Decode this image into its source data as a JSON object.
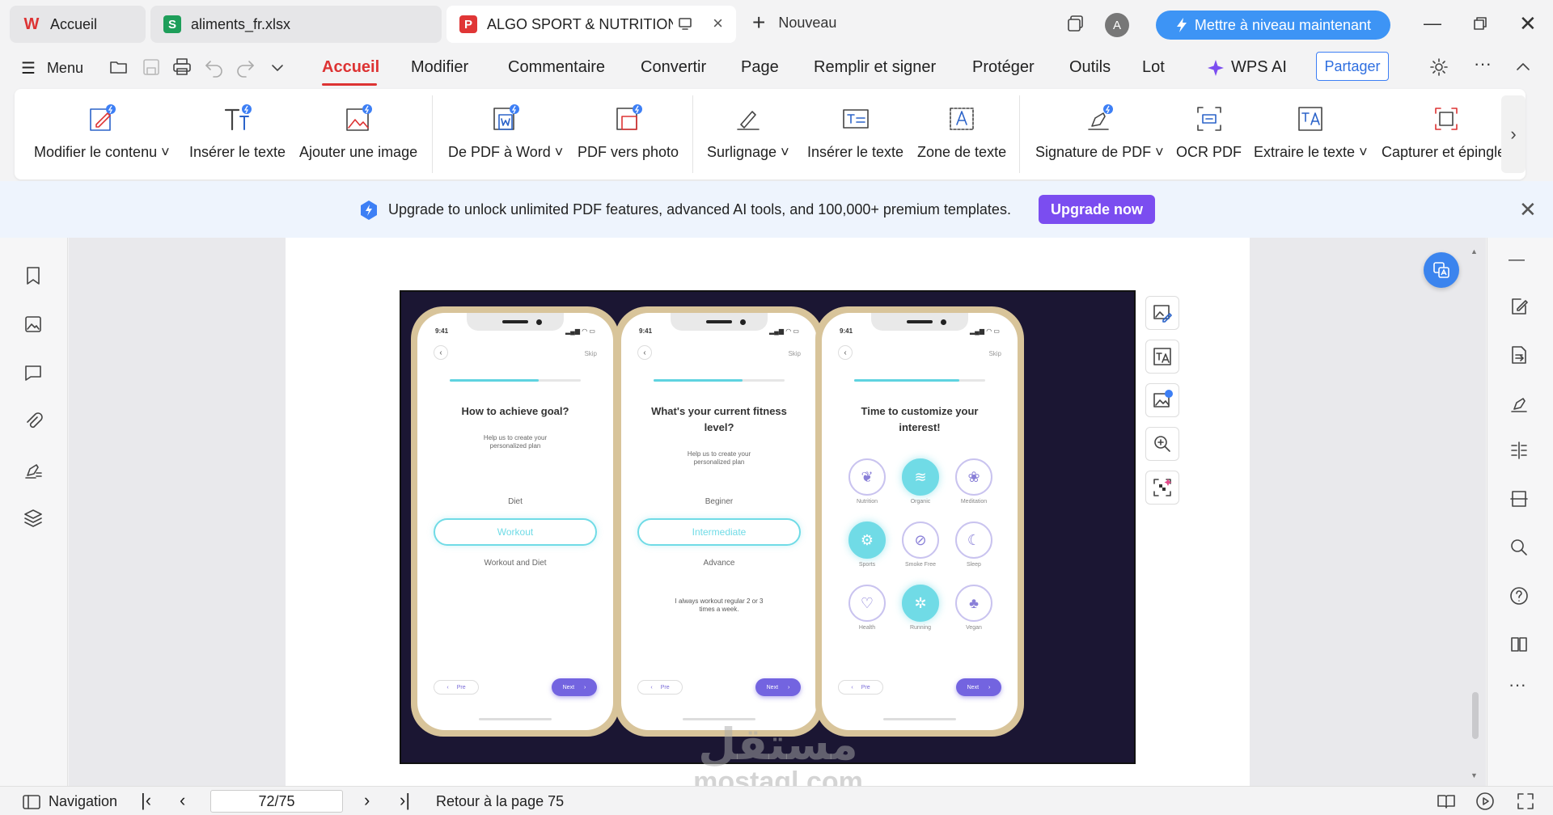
{
  "tabs": [
    {
      "label": "Accueil",
      "icon": "wps-logo-icon"
    },
    {
      "label": "aliments_fr.xlsx",
      "icon": "spreadsheet-icon"
    },
    {
      "label": "ALGO SPORT & NUTRITIONS",
      "icon": "pdf-icon"
    }
  ],
  "new_tab_label": "Nouveau",
  "avatar_letter": "A",
  "upgrade_button": "Mettre à niveau maintenant",
  "menu": {
    "menu_label": "Menu",
    "items": [
      "Accueil",
      "Modifier",
      "Commentaire",
      "Convertir",
      "Page",
      "Remplir et signer",
      "Protéger",
      "Outils",
      "Lot",
      "WPS AI"
    ],
    "active": "Accueil",
    "share": "Partager"
  },
  "ribbon": [
    {
      "label": "Modifier le contenu",
      "dropdown": true,
      "icon": "edit-content-icon"
    },
    {
      "label": "Insérer le texte",
      "dropdown": false,
      "icon": "insert-text-icon"
    },
    {
      "label": "Ajouter une image",
      "dropdown": false,
      "icon": "add-image-icon"
    },
    {
      "label": "De PDF à Word",
      "dropdown": true,
      "icon": "pdf-to-word-icon"
    },
    {
      "label": "PDF vers photo",
      "dropdown": false,
      "icon": "pdf-to-photo-icon"
    },
    {
      "label": "Surlignage",
      "dropdown": true,
      "icon": "highlight-icon"
    },
    {
      "label": "Insérer le texte",
      "dropdown": false,
      "icon": "insert-textbox-icon"
    },
    {
      "label": "Zone de texte",
      "dropdown": false,
      "icon": "text-zone-icon"
    },
    {
      "label": "Signature de PDF",
      "dropdown": true,
      "icon": "signature-icon"
    },
    {
      "label": "OCR PDF",
      "dropdown": false,
      "icon": "ocr-icon"
    },
    {
      "label": "Extraire le texte",
      "dropdown": true,
      "icon": "extract-text-icon"
    },
    {
      "label": "Capturer et épingler",
      "dropdown": false,
      "icon": "capture-pin-icon"
    }
  ],
  "banner": {
    "text": "Upgrade to unlock unlimited PDF features, advanced AI tools, and 100,000+ premium templates.",
    "button": "Upgrade now"
  },
  "phones": [
    {
      "time": "9:41",
      "skip": "Skip",
      "progress": 0.68,
      "title": "How to achieve goal?",
      "subtitle": "Help us to create your personalized plan",
      "options": [
        "Diet",
        "Workout",
        "Workout and Diet"
      ],
      "selected": "Workout",
      "note": "",
      "pre": "Pre",
      "next": "Next"
    },
    {
      "time": "9:41",
      "skip": "Skip",
      "progress": 0.68,
      "title": "What's your current fitness level?",
      "subtitle": "Help us to create your personalized plan",
      "options": [
        "Beginer",
        "Intermediate",
        "Advance"
      ],
      "selected": "Intermediate",
      "note": "I always workout regular 2 or 3 times a week.",
      "pre": "Pre",
      "next": "Next"
    },
    {
      "time": "9:41",
      "skip": "Skip",
      "progress": 0.8,
      "title": "Time to customize your interest!",
      "interests": [
        {
          "label": "Nutrition",
          "selected": false,
          "icon": "nutrition-icon"
        },
        {
          "label": "Organic",
          "selected": true,
          "icon": "organic-icon"
        },
        {
          "label": "Meditation",
          "selected": false,
          "icon": "meditation-icon"
        },
        {
          "label": "Sports",
          "selected": true,
          "icon": "sports-icon"
        },
        {
          "label": "Smoke Free",
          "selected": false,
          "icon": "smoke-free-icon"
        },
        {
          "label": "Sleep",
          "selected": false,
          "icon": "sleep-icon"
        },
        {
          "label": "Health",
          "selected": false,
          "icon": "health-icon"
        },
        {
          "label": "Running",
          "selected": true,
          "icon": "running-icon"
        },
        {
          "label": "Vegan",
          "selected": false,
          "icon": "vegan-icon"
        }
      ],
      "pre": "Pre",
      "next": "Next"
    }
  ],
  "watermark": {
    "arabic": "مستقل",
    "latin": "mostaql.com"
  },
  "statusbar": {
    "navigation": "Navigation",
    "page_value": "72/75",
    "return_label": "Retour à la page 75"
  },
  "colors": {
    "accent_red": "#d33333",
    "brand_blue": "#3d94f5",
    "upgrade_purple": "#7b4df0",
    "phone_teal": "#70dbe6",
    "phone_purple": "#7364e0"
  }
}
